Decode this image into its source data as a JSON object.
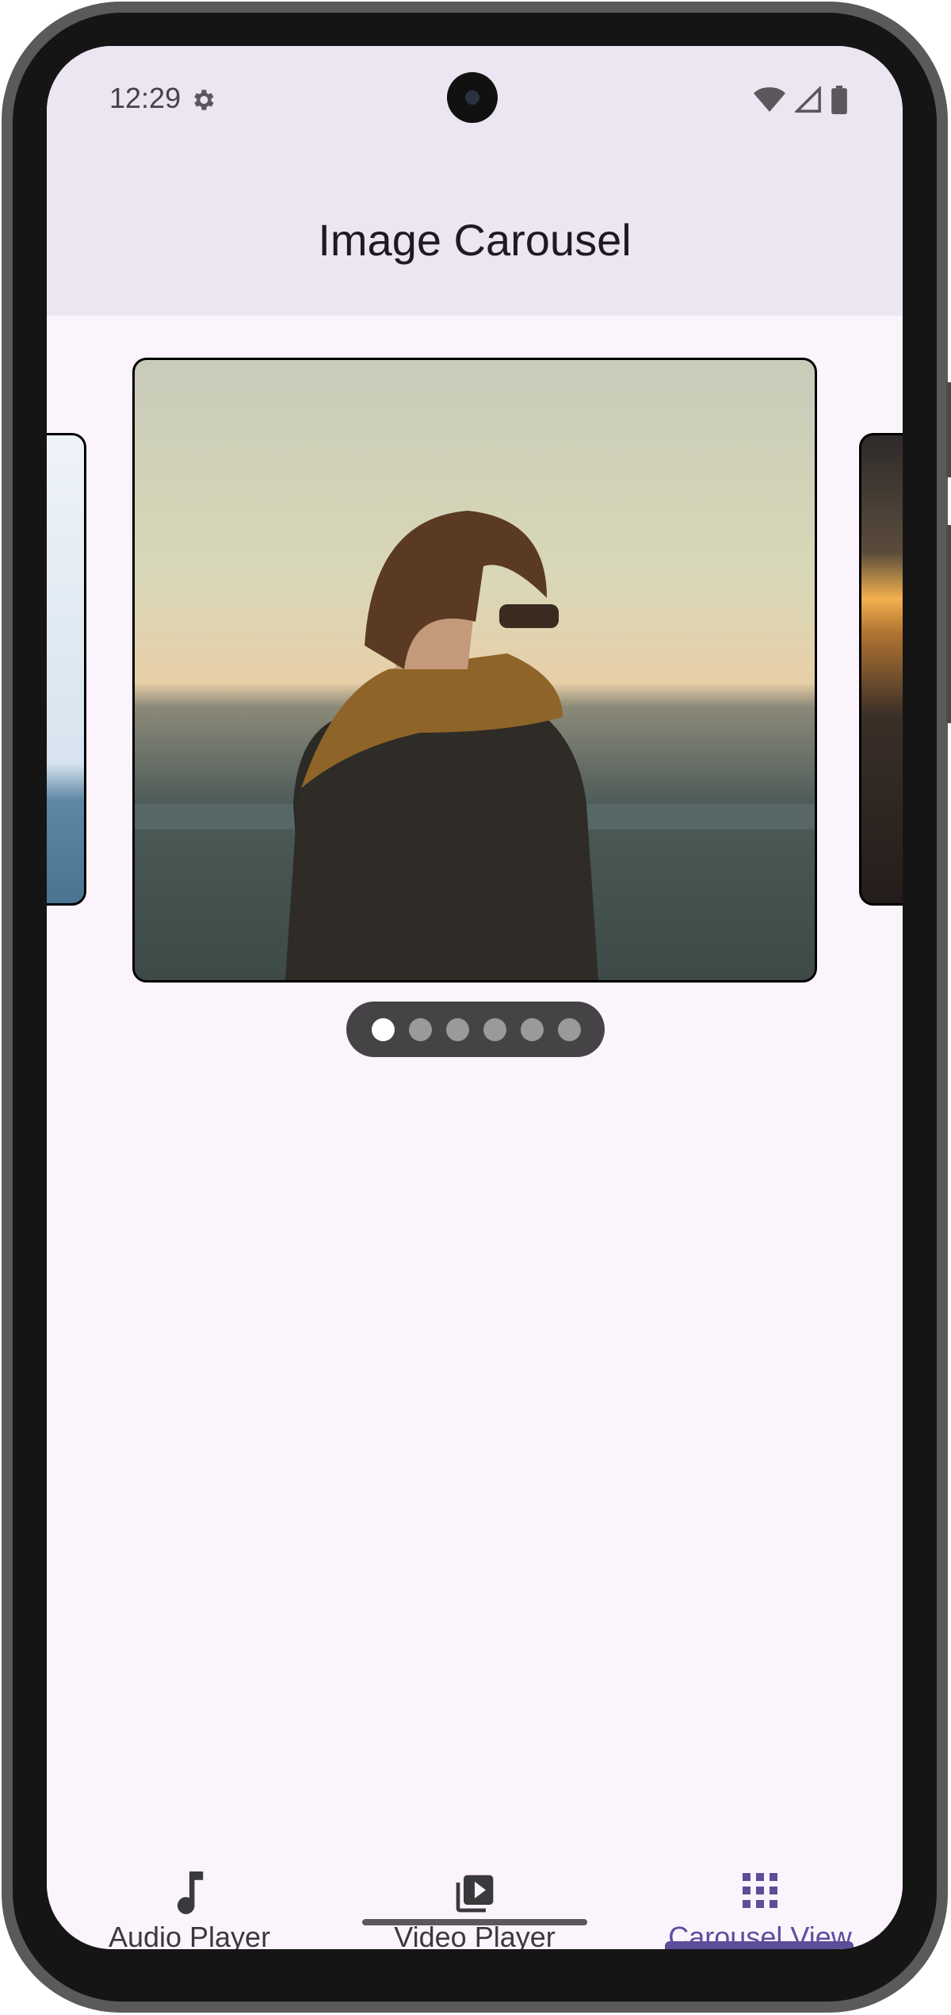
{
  "status_bar": {
    "time": "12:29",
    "icons": [
      "settings-icon",
      "wifi-icon",
      "cellular-signal-icon",
      "battery-icon"
    ]
  },
  "app_bar": {
    "title": "Image Carousel"
  },
  "carousel": {
    "total_slides": 6,
    "active_index": 0,
    "slides": [
      {
        "description": "photo",
        "position": "main"
      },
      {
        "description": "photo",
        "position": "previous-peek"
      },
      {
        "description": "photo",
        "position": "next-peek"
      }
    ]
  },
  "bottom_nav": {
    "items": [
      {
        "label": "Audio Player",
        "icon": "music-note-icon"
      },
      {
        "label": "Video Player",
        "icon": "video-library-icon"
      },
      {
        "label": "Carousel View",
        "icon": "apps-grid-icon"
      }
    ],
    "active": "Carousel View"
  },
  "colors": {
    "accent": "#5f4d9f",
    "surface": "#fcf4fc",
    "app_bar": "#ece5f2"
  }
}
